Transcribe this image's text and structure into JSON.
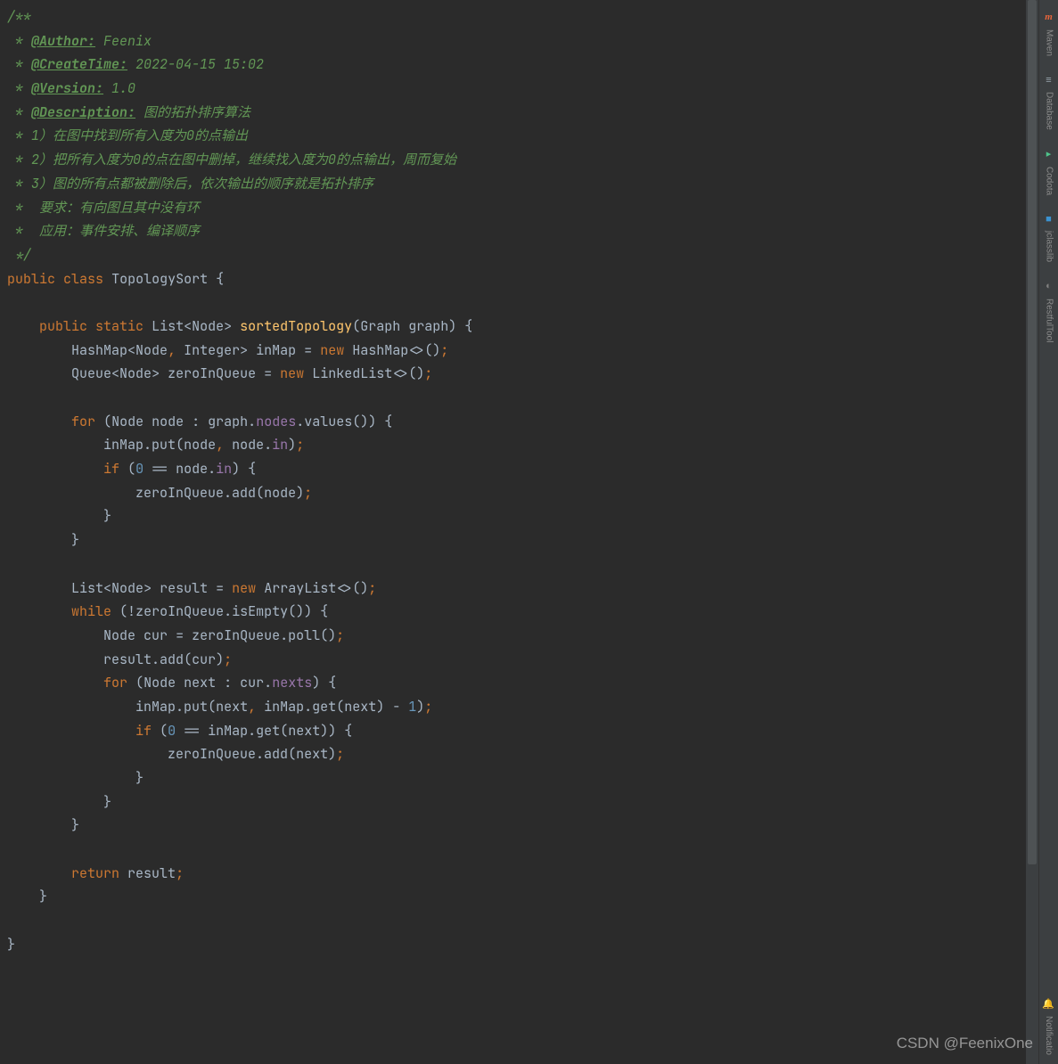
{
  "doc": {
    "open": "/**",
    "authorTag": "@Author:",
    "authorVal": " Feenix",
    "createTag": "@CreateTime:",
    "createVal": " 2022-04-15 15:02",
    "versionTag": "@Version:",
    "versionVal": " 1.0",
    "descTag": "@Description:",
    "descVal": " 图的拓扑排序算法",
    "l1": " * 1）在图中找到所有入度为0的点输出",
    "l2": " * 2）把所有入度为0的点在图中删掉，继续找入度为0的点输出，周而复始",
    "l3": " * 3）图的所有点都被删除后，依次输出的顺序就是拓扑排序",
    "l4": " *  要求：有向图且其中没有环",
    "l5": " *  应用：事件安排、编译顺序",
    "close": " */"
  },
  "code": {
    "kw_public": "public",
    "kw_class": "class",
    "kw_static": "static",
    "kw_new": "new",
    "kw_for": "for",
    "kw_if": "if",
    "kw_while": "while",
    "kw_return": "return",
    "className": "TopologySort",
    "methodName": "sortedTopology",
    "t_List": "List",
    "t_Node": "Node",
    "t_Graph": "Graph",
    "t_HashMap": "HashMap",
    "t_Integer": "Integer",
    "t_Queue": "Queue",
    "t_LinkedList": "LinkedList",
    "t_ArrayList": "ArrayList",
    "v_graph": "graph",
    "v_inMap": "inMap",
    "v_zeroInQueue": "zeroInQueue",
    "v_node": "node",
    "v_result": "result",
    "v_cur": "cur",
    "v_next": "next",
    "f_nodes": "nodes",
    "f_in": "in",
    "f_nexts": "nexts",
    "m_values": "values",
    "m_put": "put",
    "m_add": "add",
    "m_isEmpty": "isEmpty",
    "m_poll": "poll",
    "m_get": "get",
    "n_0": "0",
    "n_1": "1"
  },
  "tools": {
    "maven": "Maven",
    "database": "Database",
    "codota": "Codota",
    "jclasslib": "jclasslib",
    "restful": "RestfulTool",
    "notif": "Notificatio"
  },
  "watermark": "CSDN @FeenixOne"
}
